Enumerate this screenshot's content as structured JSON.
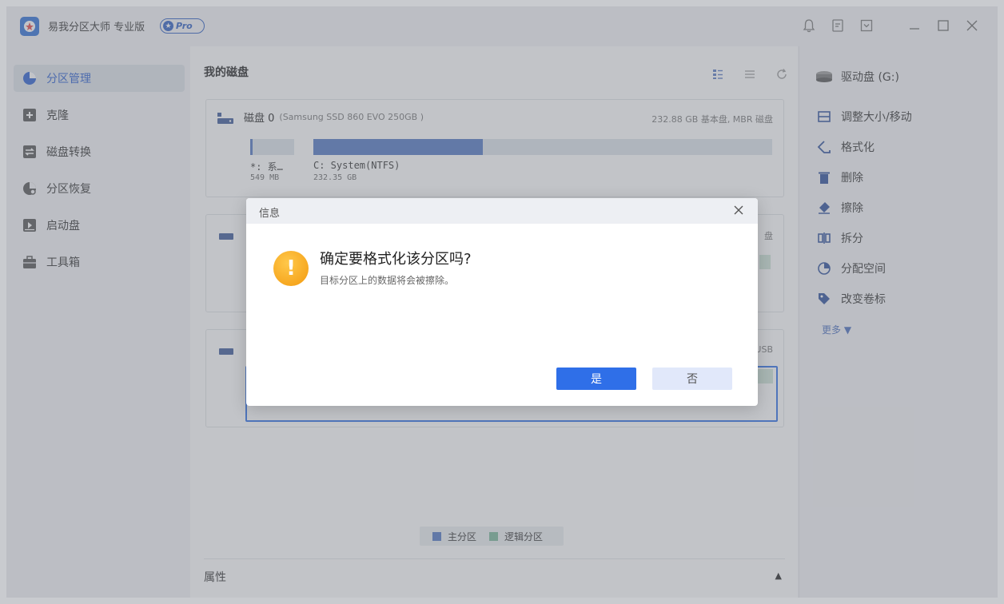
{
  "app": {
    "title": "易我分区大师 专业版",
    "pro_label": "Pro"
  },
  "sidebar": {
    "items": [
      {
        "label": "分区管理",
        "icon": "pie-chart-icon"
      },
      {
        "label": "克隆",
        "icon": "clone-icon"
      },
      {
        "label": "磁盘转换",
        "icon": "convert-icon"
      },
      {
        "label": "分区恢复",
        "icon": "recovery-icon"
      },
      {
        "label": "启动盘",
        "icon": "boot-disk-icon"
      },
      {
        "label": "工具箱",
        "icon": "toolbox-icon"
      }
    ]
  },
  "main": {
    "title": "我的磁盘",
    "disk0": {
      "name": "磁盘 0",
      "model": "(Samsung SSD 860 EVO 250GB )",
      "meta": "232.88 GB 基本盘, MBR 磁盘",
      "partitions": [
        {
          "label": "*: 系…",
          "size": "549 MB",
          "used_fraction": 0.05
        },
        {
          "label": "C: System(NTFS)",
          "size": "232.35 GB",
          "used_fraction": 0.37
        }
      ]
    },
    "disk1_meta_partial": "盘",
    "disk2_meta_partial": "USB",
    "legend": {
      "primary": "主分区",
      "logical": "逻辑分区",
      "primary_color": "#5077c4",
      "logical_color": "#79b69a"
    },
    "properties_label": "属性"
  },
  "right": {
    "drive_label": "驱动盘 (G:)",
    "operations": [
      "调整大小/移动",
      "格式化",
      "删除",
      "擦除",
      "拆分",
      "分配空间",
      "改变卷标"
    ],
    "more_label": "更多"
  },
  "dialog": {
    "title": "信息",
    "message": "确定要格式化该分区吗?",
    "sub": "目标分区上的数据将会被擦除。",
    "yes": "是",
    "no": "否"
  }
}
